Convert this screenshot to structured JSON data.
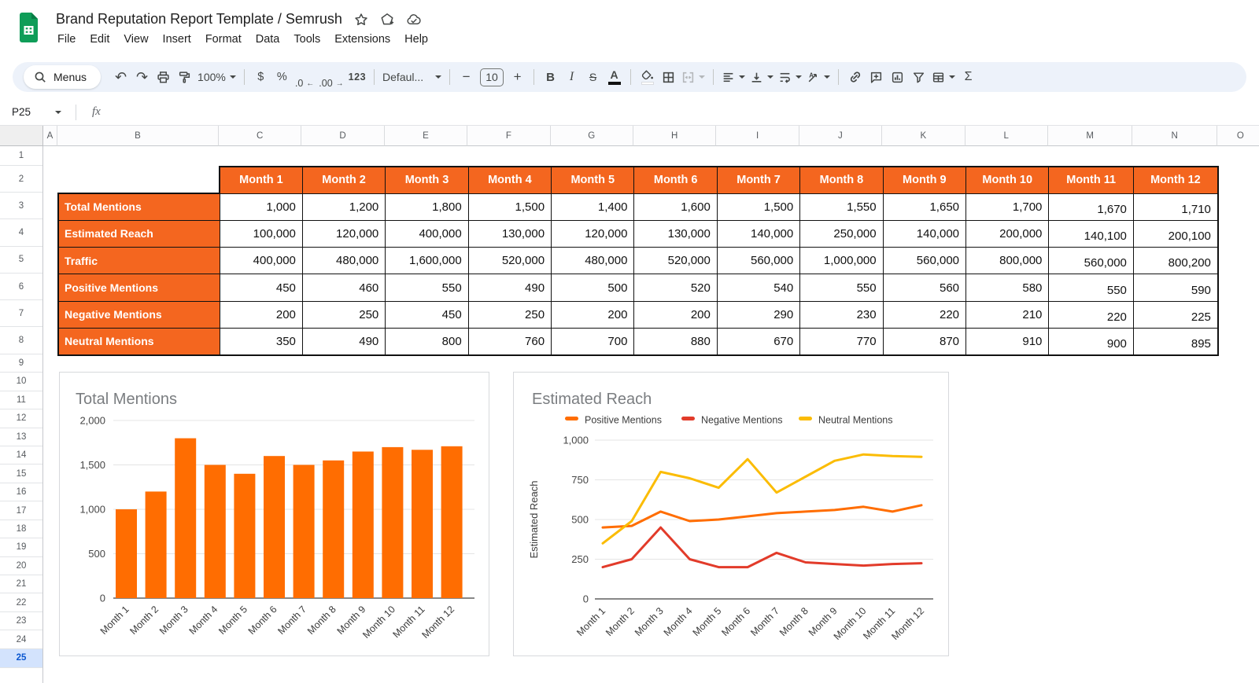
{
  "app": {
    "title": "Brand Reputation Report Template / Semrush",
    "menu": [
      "File",
      "Edit",
      "View",
      "Insert",
      "Format",
      "Data",
      "Tools",
      "Extensions",
      "Help"
    ]
  },
  "toolbar": {
    "menus_label": "Menus",
    "zoom": "100%",
    "currency": "$",
    "percent": "%",
    "decrease_decimals": ".0",
    "increase_decimals": ".00",
    "decrease_arrow": "←",
    "increase_arrow": "→",
    "number_format": "123",
    "font_name": "Defaul...",
    "font_size": "10",
    "minus": "−",
    "plus": "+",
    "undo": "↶",
    "redo": "↷",
    "bold": "B",
    "italic": "I",
    "strikethrough": "S",
    "text_color": "A",
    "functions": "Σ"
  },
  "formula_bar": {
    "name_box": "P25",
    "fx_label": "fx",
    "formula": ""
  },
  "grid": {
    "columns": [
      "A",
      "B",
      "C",
      "D",
      "E",
      "F",
      "G",
      "H",
      "I",
      "J",
      "K",
      "L",
      "M",
      "N",
      "O"
    ],
    "rows": [
      1,
      2,
      3,
      4,
      5,
      6,
      7,
      8,
      9,
      10,
      11,
      12,
      13,
      14,
      15,
      16,
      17,
      18,
      19,
      20,
      21,
      22,
      23,
      24,
      25
    ],
    "selected_row": 25
  },
  "colors": {
    "table_orange": "#f4661f",
    "chart_orange": "#ff6d01",
    "negative_red": "#e23b2a",
    "neutral_yellow": "#fbbc04"
  },
  "table": {
    "months": [
      "Month 1",
      "Month 2",
      "Month 3",
      "Month 4",
      "Month 5",
      "Month 6",
      "Month 7",
      "Month 8",
      "Month 9",
      "Month 10",
      "Month 11",
      "Month 12"
    ],
    "rows": [
      {
        "label": "Total Mentions",
        "values": [
          "1,000",
          "1,200",
          "1,800",
          "1,500",
          "1,400",
          "1,600",
          "1,500",
          "1,550",
          "1,650",
          "1,700",
          "1,670",
          "1,710"
        ]
      },
      {
        "label": "Estimated Reach",
        "values": [
          "100,000",
          "120,000",
          "400,000",
          "130,000",
          "120,000",
          "130,000",
          "140,000",
          "250,000",
          "140,000",
          "200,000",
          "140,100",
          "200,100"
        ]
      },
      {
        "label": "Traffic",
        "values": [
          "400,000",
          "480,000",
          "1,600,000",
          "520,000",
          "480,000",
          "520,000",
          "560,000",
          "1,000,000",
          "560,000",
          "800,000",
          "560,000",
          "800,200"
        ]
      },
      {
        "label": "Positive Mentions",
        "values": [
          "450",
          "460",
          "550",
          "490",
          "500",
          "520",
          "540",
          "550",
          "560",
          "580",
          "550",
          "590"
        ]
      },
      {
        "label": "Negative Mentions",
        "values": [
          "200",
          "250",
          "450",
          "250",
          "200",
          "200",
          "290",
          "230",
          "220",
          "210",
          "220",
          "225"
        ]
      },
      {
        "label": "Neutral Mentions",
        "values": [
          "350",
          "490",
          "800",
          "760",
          "700",
          "880",
          "670",
          "770",
          "870",
          "910",
          "900",
          "895"
        ]
      }
    ]
  },
  "chart_data": [
    {
      "type": "bar",
      "title": "Total Mentions",
      "categories": [
        "Month 1",
        "Month 2",
        "Month 3",
        "Month 4",
        "Month 5",
        "Month 6",
        "Month 7",
        "Month 8",
        "Month 9",
        "Month 10",
        "Month 11",
        "Month 12"
      ],
      "values": [
        1000,
        1200,
        1800,
        1500,
        1400,
        1600,
        1500,
        1550,
        1650,
        1700,
        1670,
        1710
      ],
      "ylim": [
        0,
        2000
      ],
      "yticks": [
        0,
        500,
        1000,
        1500,
        2000
      ],
      "ytick_labels": [
        "0",
        "500",
        "1,000",
        "1,500",
        "2,000"
      ],
      "bar_color": "#ff6d01",
      "grid": true,
      "legend": "none"
    },
    {
      "type": "line",
      "title": "Estimated Reach",
      "ylabel": "Estimated Reach",
      "categories": [
        "Month 1",
        "Month 2",
        "Month 3",
        "Month 4",
        "Month 5",
        "Month 6",
        "Month 7",
        "Month 8",
        "Month 9",
        "Month 10",
        "Month 11",
        "Month 12"
      ],
      "series": [
        {
          "name": "Positive Mentions",
          "color": "#ff6d01",
          "values": [
            450,
            460,
            550,
            490,
            500,
            520,
            540,
            550,
            560,
            580,
            550,
            590
          ]
        },
        {
          "name": "Negative Mentions",
          "color": "#e23b2a",
          "values": [
            200,
            250,
            450,
            250,
            200,
            200,
            290,
            230,
            220,
            210,
            220,
            225
          ]
        },
        {
          "name": "Neutral Mentions",
          "color": "#fbbc04",
          "values": [
            350,
            490,
            800,
            760,
            700,
            880,
            670,
            770,
            870,
            910,
            900,
            895
          ]
        }
      ],
      "ylim": [
        0,
        1000
      ],
      "yticks": [
        0,
        250,
        500,
        750,
        1000
      ],
      "ytick_labels": [
        "0",
        "250",
        "500",
        "750",
        "1,000"
      ],
      "grid": true,
      "legend_position": "top"
    }
  ]
}
